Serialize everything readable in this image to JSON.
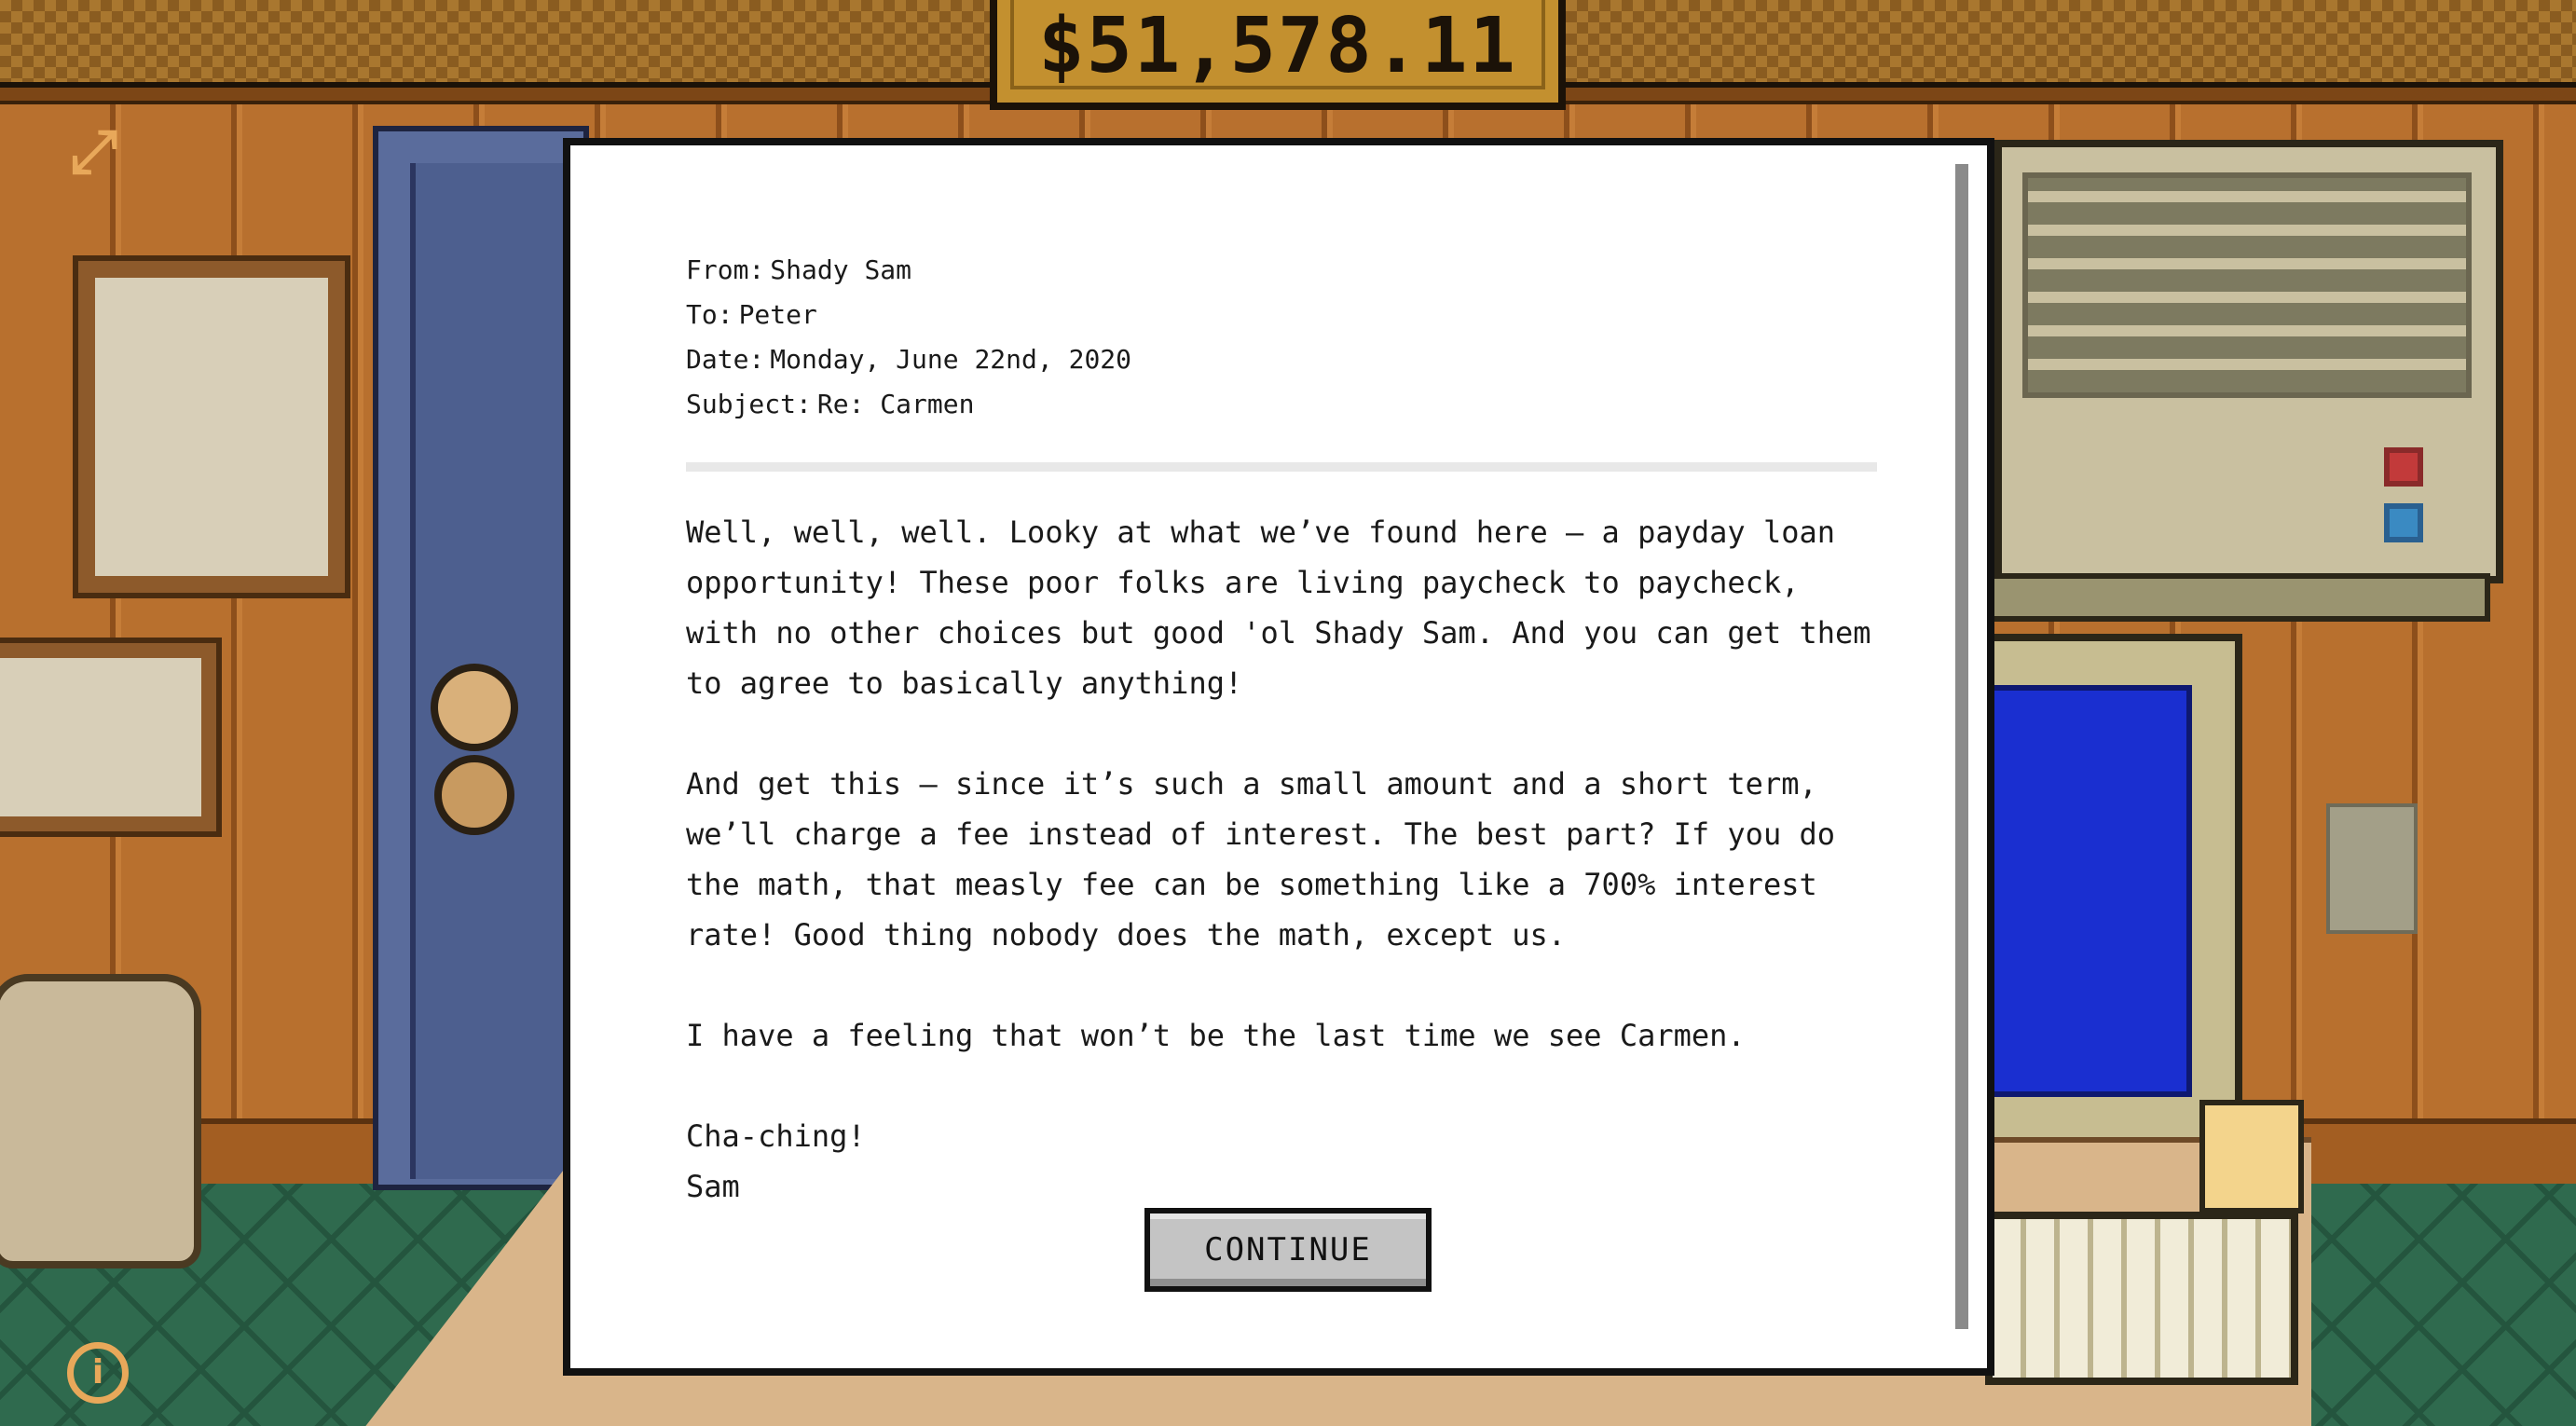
{
  "hud": {
    "money": "$51,578.11",
    "expand_icon": "expand-arrows-icon",
    "info_icon": "info-icon"
  },
  "email": {
    "from_label": "From:",
    "from": "Shady Sam",
    "to_label": "To:",
    "to": "Peter",
    "date_label": "Date:",
    "date": "Monday, June 22nd, 2020",
    "subject_label": "Subject:",
    "subject": "Re: Carmen",
    "paragraphs": [
      "Well, well, well. Looky at what we’ve found here – a payday loan opportunity! These poor folks are living paycheck to paycheck, with no other choices but good 'ol Shady Sam. And you can get them to agree to basically anything!",
      "And get this – since it’s such a small amount and a short term, we’ll charge a fee instead of interest. The best part? If you do the math, that measly fee can be something like a 700% interest rate! Good thing nobody does the math, except us.",
      "I have a feeling that won’t be the last time we see Carmen."
    ],
    "signoff": "Cha-ching!",
    "signature": "Sam"
  },
  "dialog": {
    "continue_label": "CONTINUE"
  },
  "colors": {
    "money_box": "#c3902f",
    "wall": "#b8702e",
    "floor": "#2f6a4e",
    "door": "#5a6c9c",
    "monitor_screen": "#1a2fd0"
  }
}
